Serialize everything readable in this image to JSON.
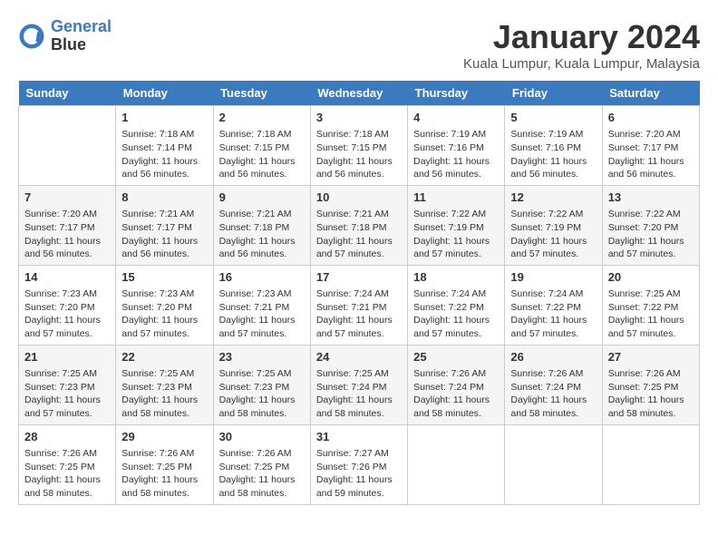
{
  "header": {
    "logo_line1": "General",
    "logo_line2": "Blue",
    "month_year": "January 2024",
    "location": "Kuala Lumpur, Kuala Lumpur, Malaysia"
  },
  "days_of_week": [
    "Sunday",
    "Monday",
    "Tuesday",
    "Wednesday",
    "Thursday",
    "Friday",
    "Saturday"
  ],
  "weeks": [
    [
      {
        "num": "",
        "info": ""
      },
      {
        "num": "1",
        "info": "Sunrise: 7:18 AM\nSunset: 7:14 PM\nDaylight: 11 hours\nand 56 minutes."
      },
      {
        "num": "2",
        "info": "Sunrise: 7:18 AM\nSunset: 7:15 PM\nDaylight: 11 hours\nand 56 minutes."
      },
      {
        "num": "3",
        "info": "Sunrise: 7:18 AM\nSunset: 7:15 PM\nDaylight: 11 hours\nand 56 minutes."
      },
      {
        "num": "4",
        "info": "Sunrise: 7:19 AM\nSunset: 7:16 PM\nDaylight: 11 hours\nand 56 minutes."
      },
      {
        "num": "5",
        "info": "Sunrise: 7:19 AM\nSunset: 7:16 PM\nDaylight: 11 hours\nand 56 minutes."
      },
      {
        "num": "6",
        "info": "Sunrise: 7:20 AM\nSunset: 7:17 PM\nDaylight: 11 hours\nand 56 minutes."
      }
    ],
    [
      {
        "num": "7",
        "info": "Sunrise: 7:20 AM\nSunset: 7:17 PM\nDaylight: 11 hours\nand 56 minutes."
      },
      {
        "num": "8",
        "info": "Sunrise: 7:21 AM\nSunset: 7:17 PM\nDaylight: 11 hours\nand 56 minutes."
      },
      {
        "num": "9",
        "info": "Sunrise: 7:21 AM\nSunset: 7:18 PM\nDaylight: 11 hours\nand 56 minutes."
      },
      {
        "num": "10",
        "info": "Sunrise: 7:21 AM\nSunset: 7:18 PM\nDaylight: 11 hours\nand 57 minutes."
      },
      {
        "num": "11",
        "info": "Sunrise: 7:22 AM\nSunset: 7:19 PM\nDaylight: 11 hours\nand 57 minutes."
      },
      {
        "num": "12",
        "info": "Sunrise: 7:22 AM\nSunset: 7:19 PM\nDaylight: 11 hours\nand 57 minutes."
      },
      {
        "num": "13",
        "info": "Sunrise: 7:22 AM\nSunset: 7:20 PM\nDaylight: 11 hours\nand 57 minutes."
      }
    ],
    [
      {
        "num": "14",
        "info": "Sunrise: 7:23 AM\nSunset: 7:20 PM\nDaylight: 11 hours\nand 57 minutes."
      },
      {
        "num": "15",
        "info": "Sunrise: 7:23 AM\nSunset: 7:20 PM\nDaylight: 11 hours\nand 57 minutes."
      },
      {
        "num": "16",
        "info": "Sunrise: 7:23 AM\nSunset: 7:21 PM\nDaylight: 11 hours\nand 57 minutes."
      },
      {
        "num": "17",
        "info": "Sunrise: 7:24 AM\nSunset: 7:21 PM\nDaylight: 11 hours\nand 57 minutes."
      },
      {
        "num": "18",
        "info": "Sunrise: 7:24 AM\nSunset: 7:22 PM\nDaylight: 11 hours\nand 57 minutes."
      },
      {
        "num": "19",
        "info": "Sunrise: 7:24 AM\nSunset: 7:22 PM\nDaylight: 11 hours\nand 57 minutes."
      },
      {
        "num": "20",
        "info": "Sunrise: 7:25 AM\nSunset: 7:22 PM\nDaylight: 11 hours\nand 57 minutes."
      }
    ],
    [
      {
        "num": "21",
        "info": "Sunrise: 7:25 AM\nSunset: 7:23 PM\nDaylight: 11 hours\nand 57 minutes."
      },
      {
        "num": "22",
        "info": "Sunrise: 7:25 AM\nSunset: 7:23 PM\nDaylight: 11 hours\nand 58 minutes."
      },
      {
        "num": "23",
        "info": "Sunrise: 7:25 AM\nSunset: 7:23 PM\nDaylight: 11 hours\nand 58 minutes."
      },
      {
        "num": "24",
        "info": "Sunrise: 7:25 AM\nSunset: 7:24 PM\nDaylight: 11 hours\nand 58 minutes."
      },
      {
        "num": "25",
        "info": "Sunrise: 7:26 AM\nSunset: 7:24 PM\nDaylight: 11 hours\nand 58 minutes."
      },
      {
        "num": "26",
        "info": "Sunrise: 7:26 AM\nSunset: 7:24 PM\nDaylight: 11 hours\nand 58 minutes."
      },
      {
        "num": "27",
        "info": "Sunrise: 7:26 AM\nSunset: 7:25 PM\nDaylight: 11 hours\nand 58 minutes."
      }
    ],
    [
      {
        "num": "28",
        "info": "Sunrise: 7:26 AM\nSunset: 7:25 PM\nDaylight: 11 hours\nand 58 minutes."
      },
      {
        "num": "29",
        "info": "Sunrise: 7:26 AM\nSunset: 7:25 PM\nDaylight: 11 hours\nand 58 minutes."
      },
      {
        "num": "30",
        "info": "Sunrise: 7:26 AM\nSunset: 7:25 PM\nDaylight: 11 hours\nand 58 minutes."
      },
      {
        "num": "31",
        "info": "Sunrise: 7:27 AM\nSunset: 7:26 PM\nDaylight: 11 hours\nand 59 minutes."
      },
      {
        "num": "",
        "info": ""
      },
      {
        "num": "",
        "info": ""
      },
      {
        "num": "",
        "info": ""
      }
    ]
  ]
}
